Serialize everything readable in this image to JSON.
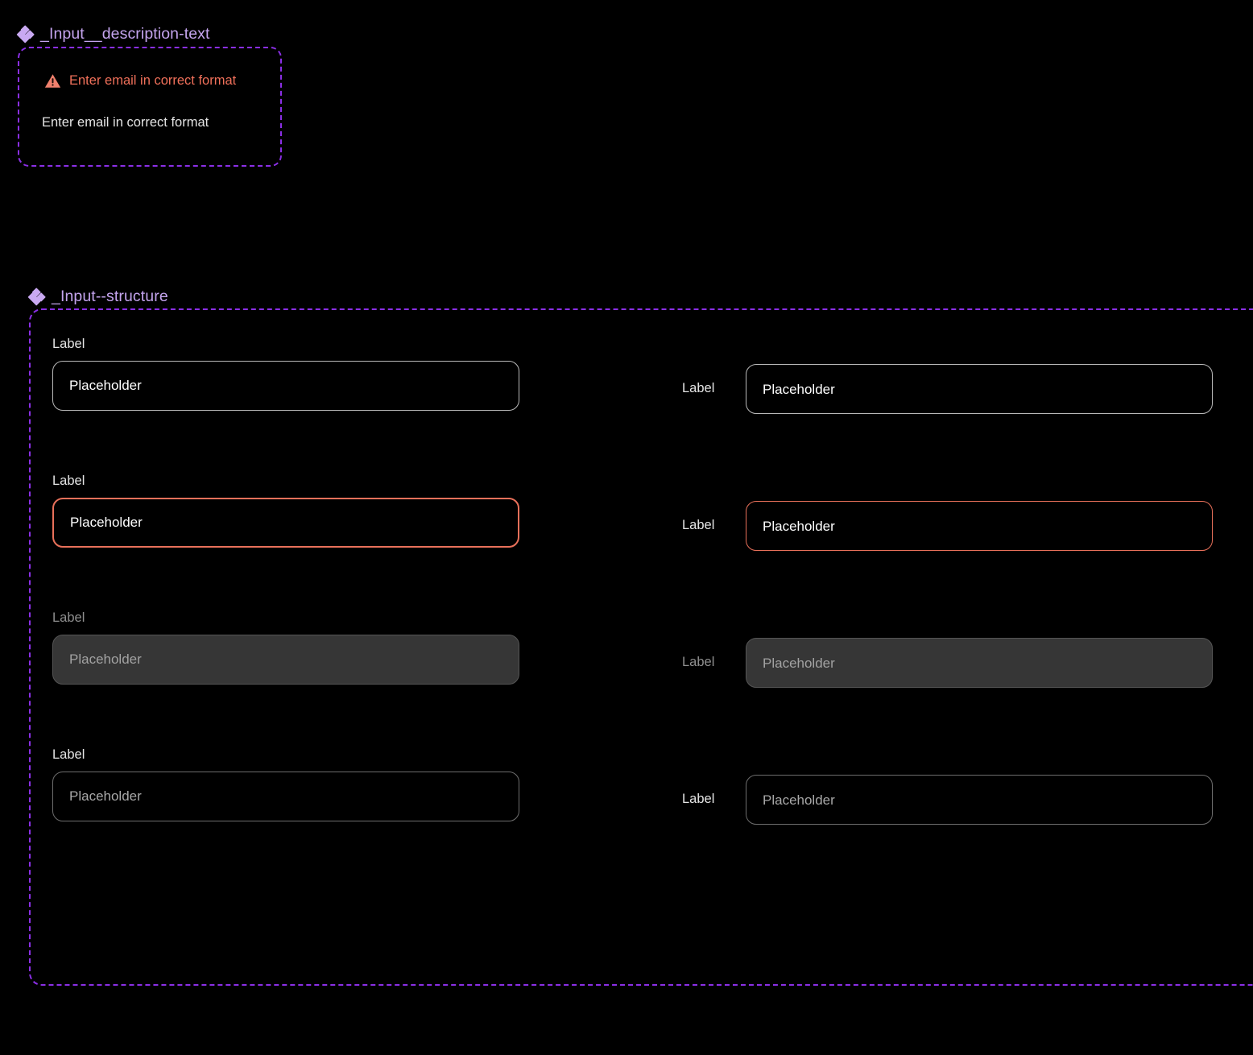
{
  "canvas": {
    "background": "#000000",
    "accent_frame_color": "#8b2fe6",
    "title_color": "#c4a4ee",
    "error_color": "#f0705a"
  },
  "frames": [
    {
      "id": "description",
      "title": "_Input__description-text",
      "icon": "component-set-icon"
    },
    {
      "id": "structure",
      "title": "_Input--structure",
      "icon": "component-set-icon"
    }
  ],
  "description_frame": {
    "error": {
      "icon": "warning-triangle-icon",
      "text": "Enter email in correct format"
    },
    "helper": {
      "text": "Enter email in correct format"
    }
  },
  "structure_frame": {
    "left_column": [
      {
        "label": "Label",
        "placeholder": "Placeholder",
        "state": "default"
      },
      {
        "label": "Label",
        "placeholder": "Placeholder",
        "state": "error"
      },
      {
        "label": "Label",
        "placeholder": "Placeholder",
        "state": "disabled"
      },
      {
        "label": "Label",
        "placeholder": "Placeholder",
        "state": "empty"
      }
    ],
    "right_column": [
      {
        "label": "Label",
        "placeholder": "Placeholder",
        "state": "default"
      },
      {
        "label": "Label",
        "placeholder": "Placeholder",
        "state": "error"
      },
      {
        "label": "Label",
        "placeholder": "Placeholder",
        "state": "disabled"
      },
      {
        "label": "Label",
        "placeholder": "Placeholder",
        "state": "empty"
      }
    ]
  }
}
